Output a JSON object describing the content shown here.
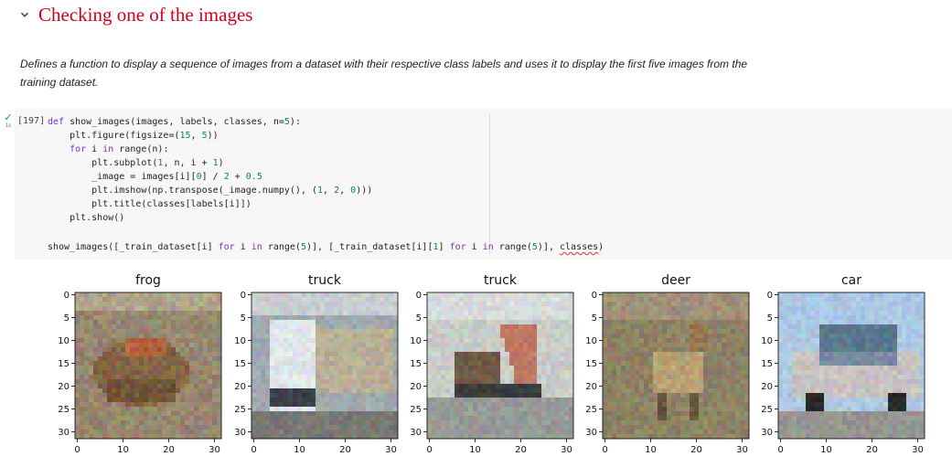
{
  "section": {
    "title": "Checking one of the images",
    "collapse_icon": "chevron-down-icon"
  },
  "description": "Defines a function to display a sequence of images from a dataset with their respective class labels and uses it to display the first five images from the training dataset.",
  "cell": {
    "count": "[197]",
    "run_status_icon": "check-icon",
    "exec_time": "1s",
    "code_lines": [
      "def show_images(images, labels, classes, n=5):",
      "    plt.figure(figsize=(15, 5))",
      "    for i in range(n):",
      "        plt.subplot(1, n, i + 1)",
      "        _image = images[i][0] / 2 + 0.5",
      "        plt.imshow(np.transpose(_image.numpy(), (1, 2, 0)))",
      "        plt.title(classes[labels[i]])",
      "    plt.show()"
    ],
    "call_line": "show_images([_train_dataset[i] for i in range(5)], [_train_dataset[i][1] for i in range(5)], classes)"
  },
  "output": {
    "titles": [
      "frog",
      "truck",
      "truck",
      "deer",
      "car"
    ],
    "y_ticks": [
      "0",
      "5",
      "10",
      "15",
      "20",
      "25",
      "30"
    ],
    "x_ticks": [
      "0",
      "10",
      "20",
      "30"
    ]
  },
  "colors": {
    "heading": "#d0021b",
    "keyword": "#7b2fbf",
    "number": "#098658",
    "success": "#0f9d58"
  }
}
